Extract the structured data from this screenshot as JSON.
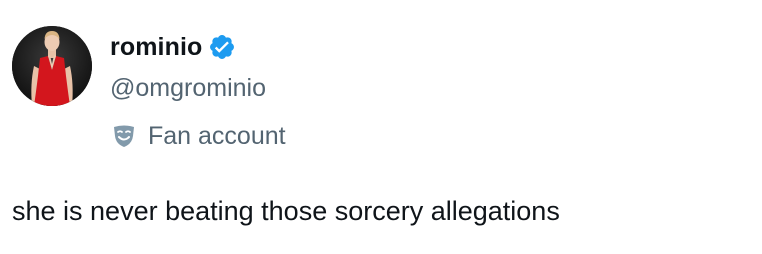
{
  "author": {
    "display_name": "rominio",
    "handle": "@omgrominio",
    "verified_icon": "verified-badge-icon",
    "avatar_icon": "profile-avatar",
    "label": "Fan account",
    "label_icon": "theater-mask-icon"
  },
  "tweet": {
    "text": "she is never beating those sorcery allegations"
  },
  "colors": {
    "primary_text": "#0f1419",
    "secondary_text": "#536471",
    "verified_blue": "#1d9bf0",
    "label_icon_gray": "#829aab"
  }
}
